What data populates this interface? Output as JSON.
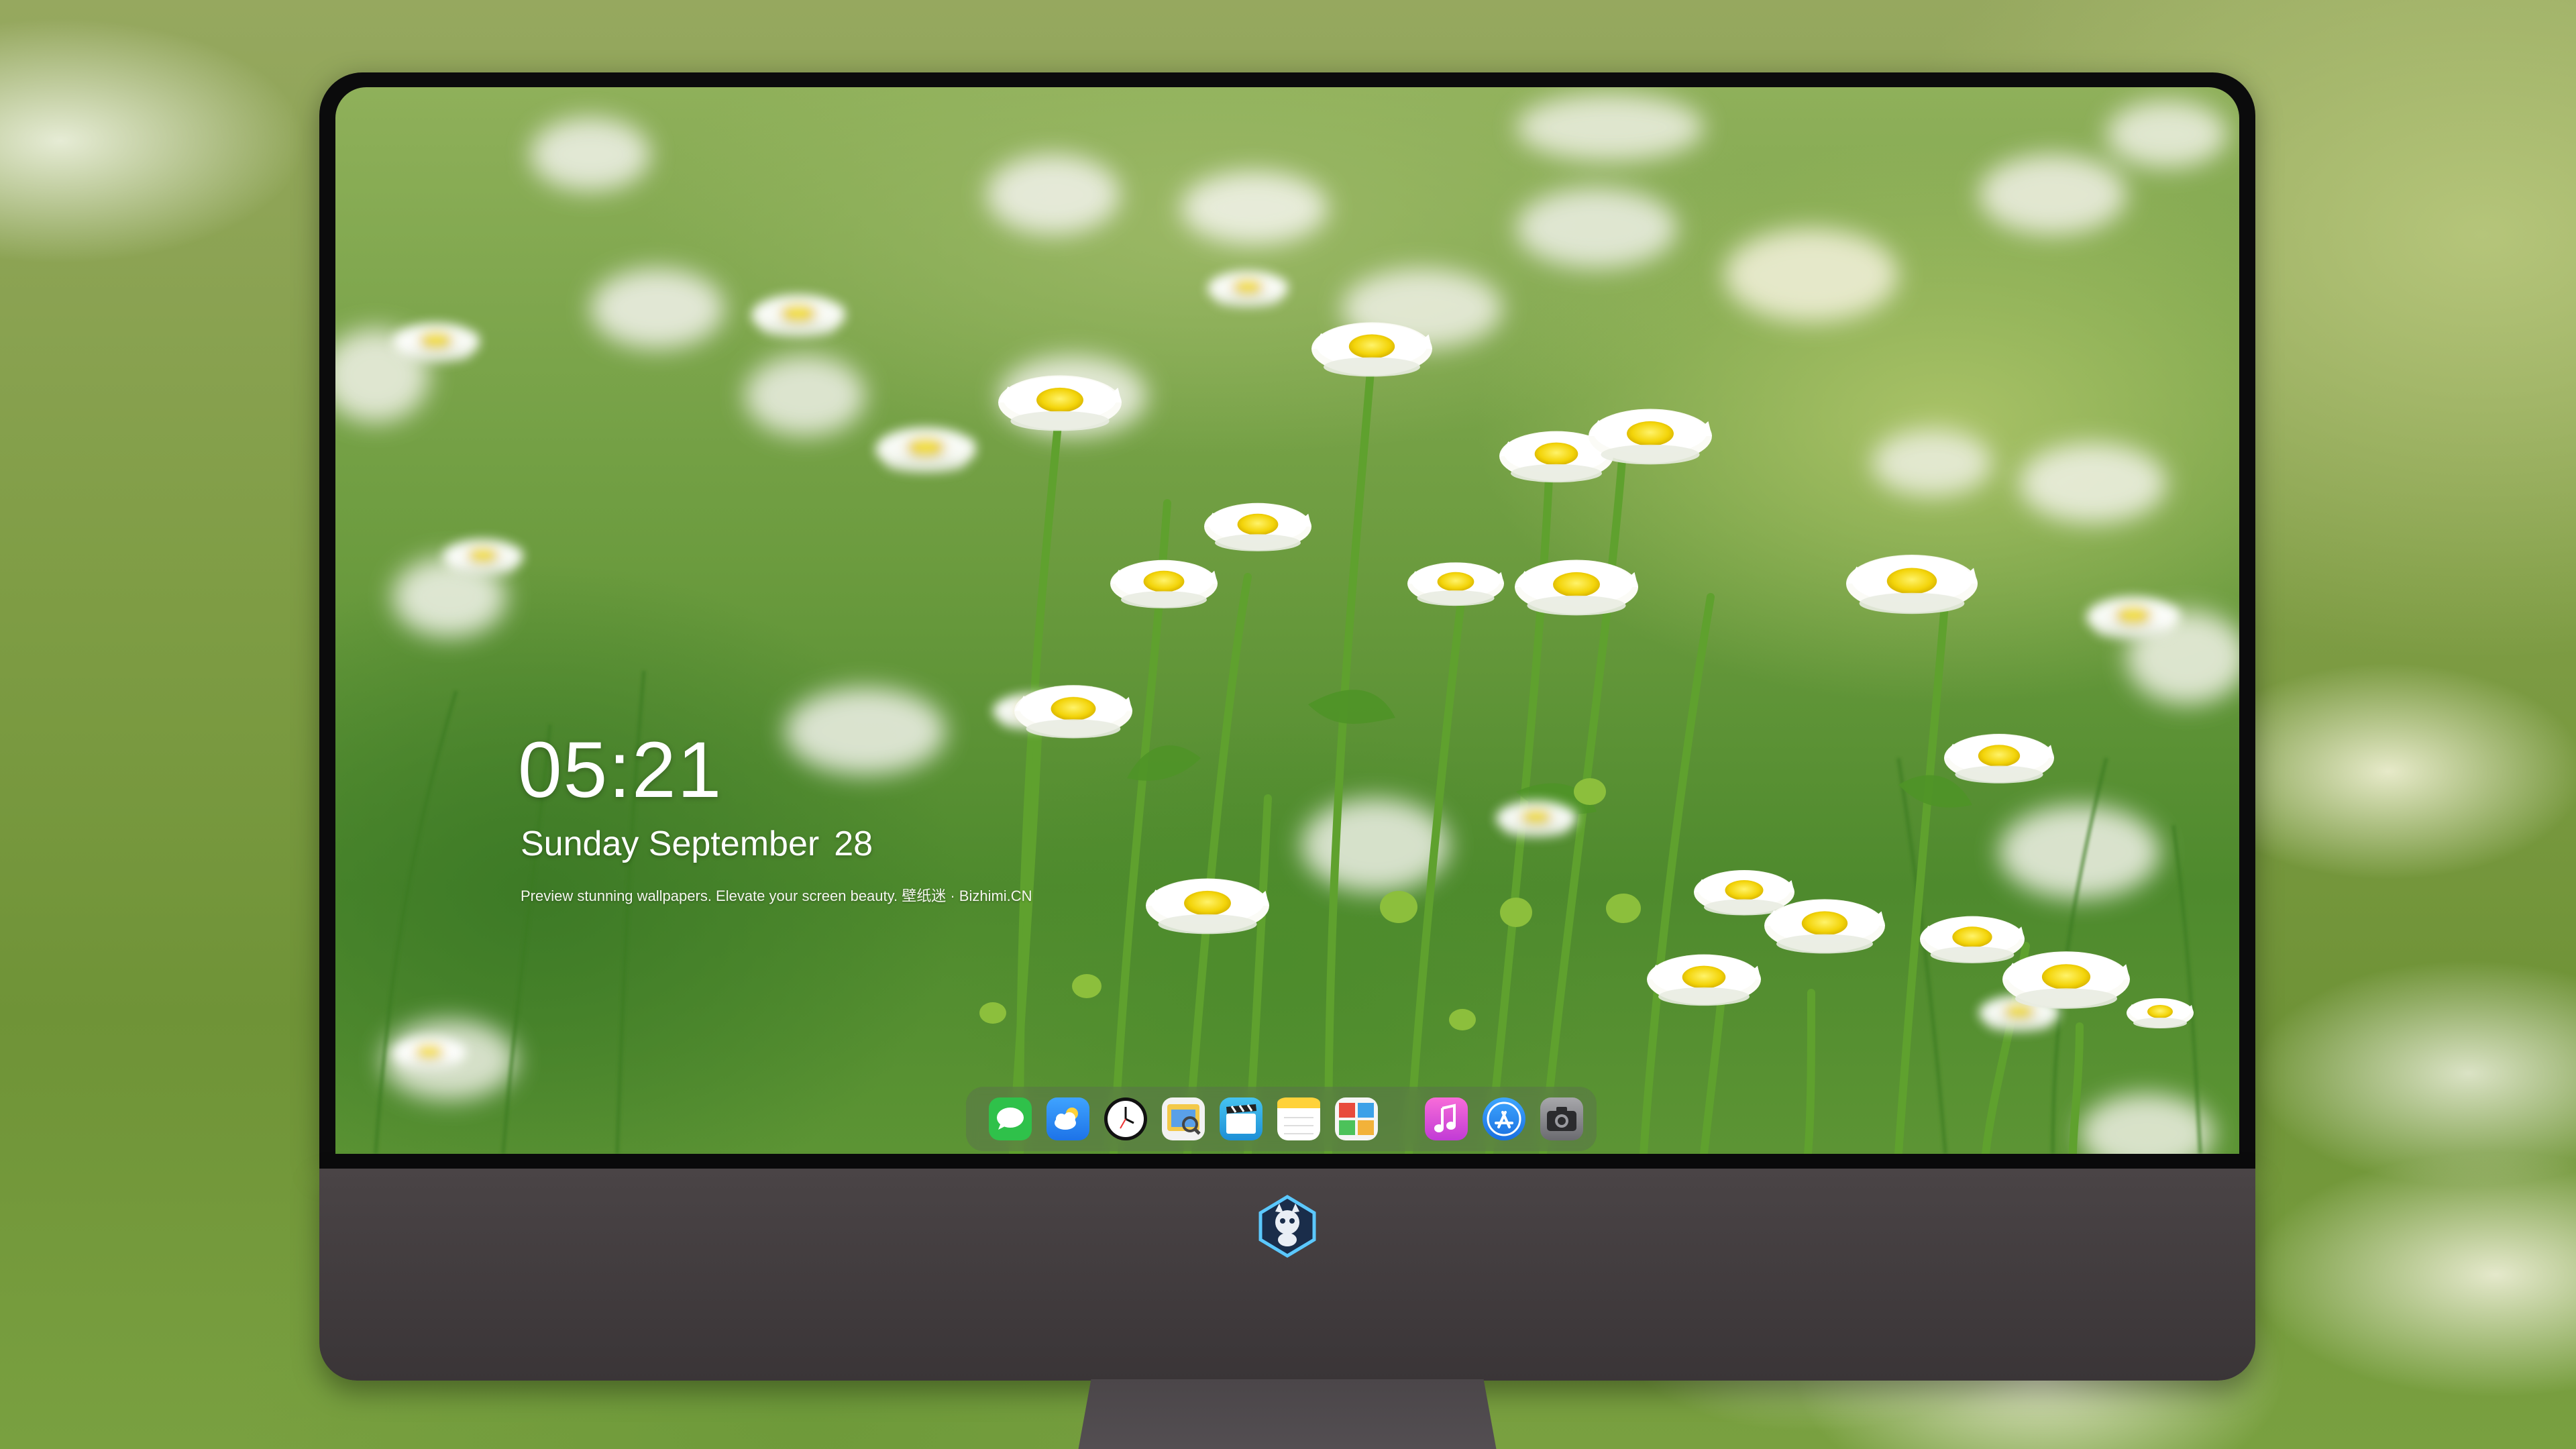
{
  "lockscreen": {
    "time": "05:21",
    "weekday_month": "Sunday September",
    "day": "28",
    "tagline": "Preview stunning wallpapers. Elevate your screen beauty. 壁纸迷 · Bizhimi.CN"
  },
  "dock": {
    "apps": [
      {
        "name": "messages",
        "icon": "message-bubble-icon",
        "color": "#32c94b"
      },
      {
        "name": "weather",
        "icon": "cloud-sun-icon",
        "color": "#2f8ff5"
      },
      {
        "name": "clock",
        "icon": "clock-icon",
        "color": "#ffffff"
      },
      {
        "name": "preview",
        "icon": "image-preview-icon",
        "color": "#f4d36b"
      },
      {
        "name": "video",
        "icon": "clapperboard-icon",
        "color": "#38b6e8"
      },
      {
        "name": "notes",
        "icon": "notes-icon",
        "color": "#ffd54a"
      },
      {
        "name": "photo-gallery",
        "icon": "photo-collage-icon",
        "color": "#f2a93b"
      },
      {
        "name": "music",
        "icon": "music-note-icon",
        "color": "#e54fc7"
      },
      {
        "name": "app-store",
        "icon": "app-store-icon",
        "color": "#2a86f0"
      },
      {
        "name": "camera",
        "icon": "camera-icon",
        "color": "#8a8a8e"
      }
    ]
  },
  "chin": {
    "logo": "mascot-logo-icon"
  }
}
